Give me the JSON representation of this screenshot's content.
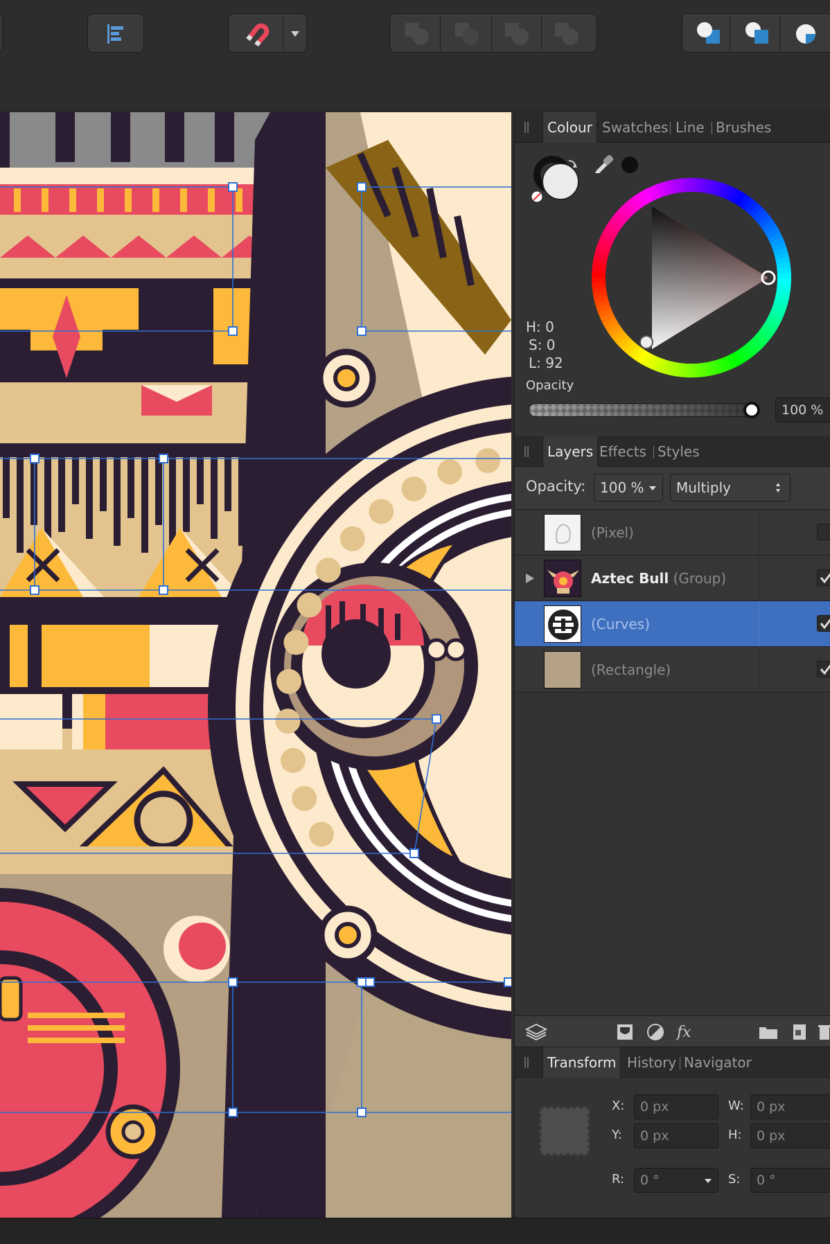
{
  "toolbar": {
    "buttons": [
      "align-icon",
      "snapping-magnet-icon",
      "snapping-options-chevron-icon",
      "boolean-add-icon",
      "boolean-subtract-icon",
      "boolean-intersect-icon",
      "boolean-divide-icon",
      "arrange-front-icon",
      "arrange-back-icon",
      "arrange-forward-icon"
    ]
  },
  "colour_panel": {
    "tabs": [
      "Colour",
      "Swatches",
      "Line",
      "Brushes"
    ],
    "hue_label": "H: 0",
    "sat_label": "S: 0",
    "light_label": "L: 92",
    "opacity_label": "Opacity",
    "opacity_value": "100 %",
    "opacity_fraction": 1.0,
    "fill_color": "#ebebeb",
    "stroke_color": "#1a1a1a",
    "picked_color": "#0f0f0f"
  },
  "layers_panel": {
    "tabs": [
      "Layers",
      "Effects",
      "Styles"
    ],
    "opacity_label": "Opacity:",
    "opacity_value": "100 %",
    "blend_mode": "Multiply",
    "layers": [
      {
        "name": "",
        "type": "(Pixel)",
        "selected": false,
        "checked": false,
        "expandable": false
      },
      {
        "name": "Aztec Bull",
        "type": "(Group)",
        "selected": false,
        "checked": true,
        "expandable": true
      },
      {
        "name": "",
        "type": "(Curves)",
        "selected": true,
        "checked": true,
        "expandable": false
      },
      {
        "name": "",
        "type": "(Rectangle)",
        "selected": false,
        "checked": true,
        "expandable": false
      }
    ],
    "footer_icons": [
      "layers-stack-icon",
      "mask-icon",
      "adjustment-icon",
      "fx-icon",
      "folder-icon",
      "new-layer-icon",
      "trash-icon"
    ]
  },
  "transform_panel": {
    "tabs": [
      "Transform",
      "History",
      "Navigator"
    ],
    "x_label": "X:",
    "x_value": "0 px",
    "y_label": "Y:",
    "y_value": "0 px",
    "w_label": "W:",
    "w_value": "0 px",
    "h_label": "H:",
    "h_value": "0 px",
    "r_label": "R:",
    "r_value": "0 °",
    "s_label": "S:",
    "s_value": "0 °"
  },
  "colors": {
    "selection_blue": "#3f6fbf",
    "guide_blue": "#2d6fd6",
    "art_dark": "#2b1e33",
    "art_cream": "#fde9cc",
    "art_red": "#e84a5f",
    "art_yellow": "#fdba3a",
    "art_tan": "#e3c48e"
  }
}
